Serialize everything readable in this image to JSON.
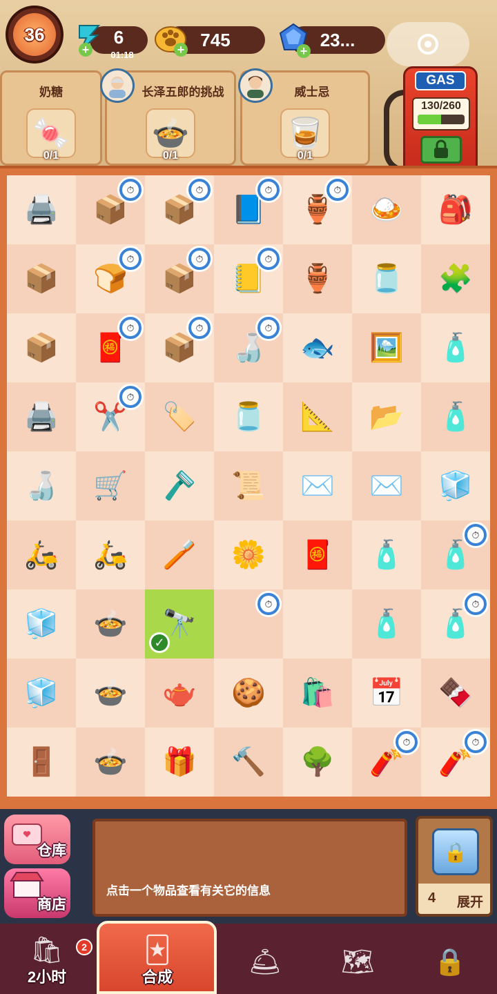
{
  "header": {
    "level": "36",
    "energy": {
      "value": "6",
      "timer": "01:18",
      "icon": "lightning-icon"
    },
    "coins": {
      "value": "745",
      "icon": "paw-coin-icon"
    },
    "gems": {
      "value": "23...",
      "icon": "blue-gem-icon"
    }
  },
  "orders": [
    {
      "title": "奶糖",
      "count": "0/1",
      "item": "🍬"
    },
    {
      "title": "长泽五郎的挑战",
      "count": "0/1",
      "item": "🍲"
    },
    {
      "title": "威士忌",
      "count": "0/1",
      "item": "🥃"
    }
  ],
  "gas": {
    "sign": "GAS",
    "value": "130/260",
    "fill": 0.5
  },
  "grid": {
    "cells": [
      [
        "🖨️",
        "📦",
        "📦",
        "📘",
        "🏺",
        "🍛",
        "🎒"
      ],
      [
        "📦",
        "🍞",
        "📦",
        "📒",
        "🏺",
        "🫙",
        "🧩"
      ],
      [
        "📦",
        "🧧",
        "📦",
        "🍶",
        "🐟",
        "🖼️",
        "🧴"
      ],
      [
        "🖨️",
        "✂️",
        "🏷️",
        "🫙",
        "📐",
        "📂",
        "🧴"
      ],
      [
        "🍶",
        "🛒",
        "🪒",
        "📜",
        "✉️",
        "✉️",
        "🧊"
      ],
      [
        "🛵",
        "🛵",
        "🪥",
        "🌼",
        "🧧",
        "🧴",
        "🧴"
      ],
      [
        "🧊",
        "🍲",
        "🔭",
        "",
        "",
        "🧴",
        "🧴"
      ],
      [
        "🧊",
        "🍲",
        "🫖",
        "🍪",
        "🛍️",
        "📅",
        "🍫"
      ],
      [
        "🚪",
        "🍲",
        "🎁",
        "🔨",
        "🌳",
        "🧨",
        "🧨"
      ]
    ],
    "timers": [
      [
        0,
        1
      ],
      [
        0,
        2
      ],
      [
        0,
        3
      ],
      [
        0,
        4
      ],
      [
        1,
        1
      ],
      [
        1,
        2
      ],
      [
        1,
        3
      ],
      [
        2,
        1
      ],
      [
        2,
        2
      ],
      [
        2,
        3
      ],
      [
        2,
        7
      ],
      [
        3,
        1
      ],
      [
        3,
        7
      ],
      [
        5,
        6
      ],
      [
        5,
        7
      ],
      [
        6,
        3
      ],
      [
        6,
        6
      ],
      [
        6,
        7
      ],
      [
        8,
        5
      ],
      [
        8,
        6
      ],
      [
        8,
        7
      ]
    ]
  },
  "info": {
    "text": "点击一个物品查看有关它的信息"
  },
  "side": {
    "warehouse": "仓库",
    "shop": "商店"
  },
  "expand": {
    "count": "4",
    "label": "展开"
  },
  "nav": {
    "orders_label": "2小时",
    "orders_badge": "2",
    "merge_label": "合成"
  }
}
